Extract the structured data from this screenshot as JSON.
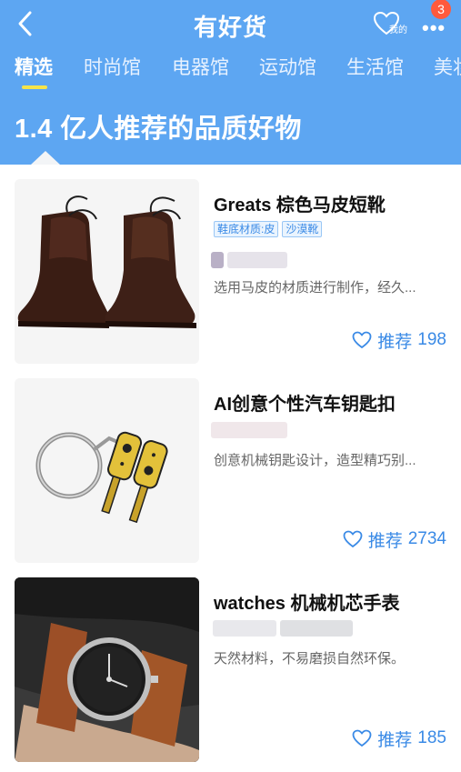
{
  "header": {
    "title": "有好货",
    "mine_label": "我的",
    "badge_count": "3",
    "headline": "1.4 亿人推荐的品质好物"
  },
  "tabs": [
    {
      "label": "精选",
      "active": true
    },
    {
      "label": "时尚馆",
      "active": false
    },
    {
      "label": "电器馆",
      "active": false
    },
    {
      "label": "运动馆",
      "active": false
    },
    {
      "label": "生活馆",
      "active": false
    },
    {
      "label": "美妆",
      "active": false
    }
  ],
  "colors": {
    "header_blue": "#5da6f2",
    "accent_blue": "#3a8ae6",
    "tab_indicator": "#f5e44a",
    "badge_red": "#ff5a3c"
  },
  "items": [
    {
      "title": "Greats 棕色马皮短靴",
      "tags": [
        "鞋底材质:皮",
        "沙漠靴"
      ],
      "desc": "选用马皮的材质进行制作，经久...",
      "recommend_label": "推荐",
      "recommend_count": "198",
      "image_icon": "leather-boots"
    },
    {
      "title": "AI创意个性汽车钥匙扣",
      "tags": [],
      "desc": "创意机械钥匙设计，造型精巧别...",
      "recommend_label": "推荐",
      "recommend_count": "2734",
      "image_icon": "keychain"
    },
    {
      "title": "watches 机械机芯手表",
      "tags": [],
      "desc": "天然材料，不易磨损自然环保。",
      "recommend_label": "推荐",
      "recommend_count": "185",
      "image_icon": "wristwatch"
    }
  ]
}
